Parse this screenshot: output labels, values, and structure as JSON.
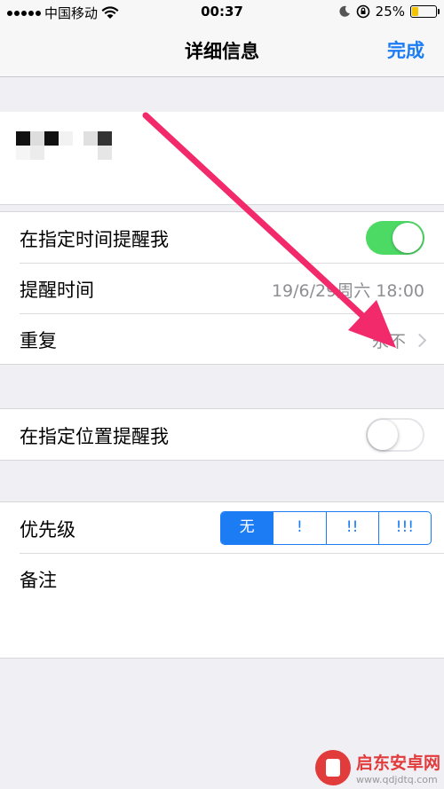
{
  "status_bar": {
    "carrier": "中国移动",
    "time": "00:37",
    "battery": "25%"
  },
  "nav": {
    "title": "详细信息",
    "done_label": "完成"
  },
  "reminder": {
    "remind_at_time_label": "在指定时间提醒我",
    "remind_at_time_on": true,
    "alarm_label": "提醒时间",
    "alarm_value": "19/6/29周六 18:00",
    "repeat_label": "重复",
    "repeat_value": "永不"
  },
  "location": {
    "remind_at_location_label": "在指定位置提醒我",
    "remind_at_location_on": false
  },
  "priority": {
    "label": "优先级",
    "options": [
      "无",
      "!",
      "!!",
      "!!!"
    ],
    "selected": "无"
  },
  "notes": {
    "label": "备注"
  },
  "colors": {
    "accent": "#1c7cf4",
    "switch_on": "#4cd964",
    "arrow": "#f2296b"
  },
  "watermark": {
    "title": "启东安卓网",
    "url": "www.qdjdtq.com"
  }
}
